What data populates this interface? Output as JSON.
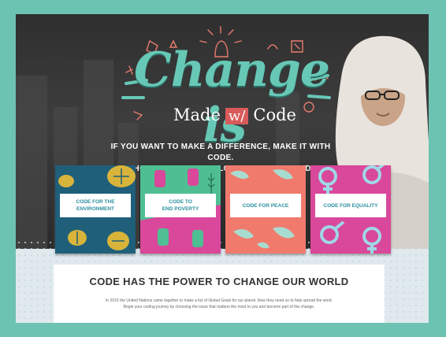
{
  "hero": {
    "title_line1": "Change is",
    "title_made": "Made",
    "title_w": "w/",
    "title_code": "Code",
    "tagline_line1": "IF YOU WANT TO MAKE A DIFFERENCE, MAKE IT WITH CODE.",
    "tagline_line2": "CHOOSE AN ISSUE BELOW TO GET STARTED."
  },
  "cards": [
    {
      "label_line1": "CODE FOR THE",
      "label_line2": "ENVIRONMENT",
      "label_color": "#2b8fa0",
      "bg": "#1f5f7a"
    },
    {
      "label_line1": "CODE TO",
      "label_line2": "END POVERTY",
      "label_color": "#2b8fa0",
      "bg": "#4fbf93"
    },
    {
      "label_line1": "CODE FOR PEACE",
      "label_line2": "",
      "label_color": "#2b8fa0",
      "bg": "#f07b6d"
    },
    {
      "label_line1": "CODE FOR EQUALITY",
      "label_line2": "",
      "label_color": "#2b8fa0",
      "bg": "#d9489a"
    }
  ],
  "mission": {
    "heading": "CODE HAS THE POWER TO CHANGE OUR WORLD",
    "body_line1": "In 2015 the United Nations came together to make a list of Global Goals for our planet. Now they need us to help spread the word.",
    "body_line2": "Begin your coding journey by choosing the issue that matters the most to you and become part of the change."
  },
  "colors": {
    "frame": "#6cc3b2",
    "accent_teal": "#67c8b6",
    "accent_red": "#d95a5a"
  }
}
